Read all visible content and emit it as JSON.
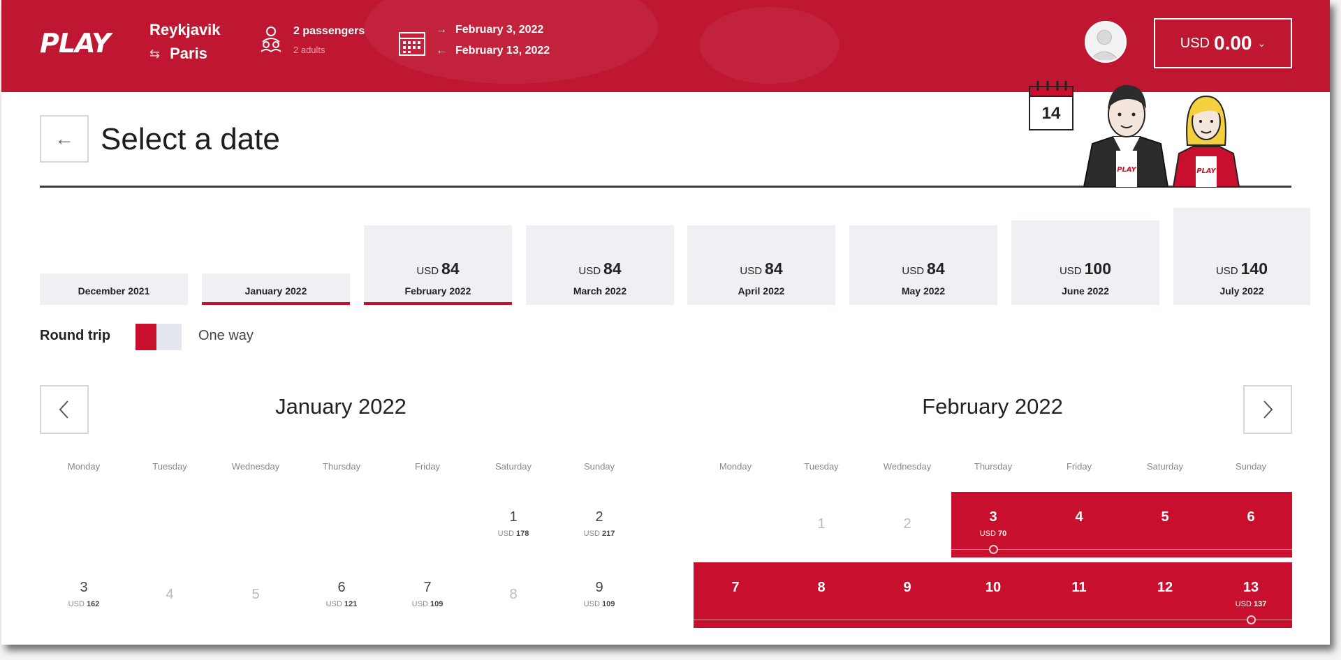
{
  "header": {
    "logo": "PLAY",
    "route": {
      "from": "Reykjavik",
      "to": "Paris",
      "swap_icon": "swap-arrows-icon"
    },
    "passengers": {
      "main": "2 passengers",
      "sub": "2 adults"
    },
    "dates": {
      "outbound": "February 3, 2022",
      "return": "February 13, 2022",
      "out_arrow": "→",
      "ret_arrow": "←"
    },
    "cart": {
      "currency": "USD",
      "amount": "0.00",
      "chevron": "⌄"
    }
  },
  "page": {
    "title": "Select a date",
    "back_icon": "←"
  },
  "month_tabs": [
    {
      "label": "December 2021",
      "currency": "",
      "price": ""
    },
    {
      "label": "January 2022",
      "currency": "",
      "price": ""
    },
    {
      "label": "February 2022",
      "currency": "USD",
      "price": "84"
    },
    {
      "label": "March 2022",
      "currency": "USD",
      "price": "84"
    },
    {
      "label": "April 2022",
      "currency": "USD",
      "price": "84"
    },
    {
      "label": "May 2022",
      "currency": "USD",
      "price": "84"
    },
    {
      "label": "June 2022",
      "currency": "USD",
      "price": "100"
    },
    {
      "label": "July 2022",
      "currency": "USD",
      "price": "140"
    }
  ],
  "trip_toggle": {
    "round_trip": "Round trip",
    "one_way": "One way",
    "selected": "Round trip"
  },
  "calendar": {
    "left": {
      "title": "January 2022",
      "weekdays": [
        "Monday",
        "Tuesday",
        "Wednesday",
        "Thursday",
        "Friday",
        "Saturday",
        "Sunday"
      ],
      "days": [
        {
          "num": "1",
          "price": "178",
          "currency": "USD"
        },
        {
          "num": "2",
          "price": "217",
          "currency": "USD"
        },
        {
          "num": "3",
          "price": "162",
          "currency": "USD"
        },
        {
          "num": "4",
          "price": "",
          "currency": ""
        },
        {
          "num": "5",
          "price": "",
          "currency": ""
        },
        {
          "num": "6",
          "price": "121",
          "currency": "USD"
        },
        {
          "num": "7",
          "price": "109",
          "currency": "USD"
        },
        {
          "num": "8",
          "price": "",
          "currency": ""
        },
        {
          "num": "9",
          "price": "109",
          "currency": "USD"
        }
      ]
    },
    "right": {
      "title": "February 2022",
      "weekdays": [
        "Monday",
        "Tuesday",
        "Wednesday",
        "Thursday",
        "Friday",
        "Saturday",
        "Sunday"
      ],
      "days": [
        {
          "num": "1",
          "price": "",
          "currency": ""
        },
        {
          "num": "2",
          "price": "",
          "currency": ""
        },
        {
          "num": "3",
          "price": "70",
          "currency": "USD"
        },
        {
          "num": "4",
          "price": "",
          "currency": ""
        },
        {
          "num": "5",
          "price": "",
          "currency": ""
        },
        {
          "num": "6",
          "price": "",
          "currency": ""
        },
        {
          "num": "7",
          "price": "",
          "currency": ""
        },
        {
          "num": "8",
          "price": "",
          "currency": ""
        },
        {
          "num": "9",
          "price": "",
          "currency": ""
        },
        {
          "num": "10",
          "price": "",
          "currency": ""
        },
        {
          "num": "11",
          "price": "",
          "currency": ""
        },
        {
          "num": "12",
          "price": "",
          "currency": ""
        },
        {
          "num": "13",
          "price": "137",
          "currency": "USD"
        }
      ]
    },
    "prev_icon": "chevron-left-icon",
    "next_icon": "chevron-right-icon"
  },
  "illustration": {
    "calendar_badge": "14"
  },
  "colors": {
    "brand": "#bf1731",
    "accent": "#c8102e",
    "tab_bg": "#eef0f4"
  }
}
